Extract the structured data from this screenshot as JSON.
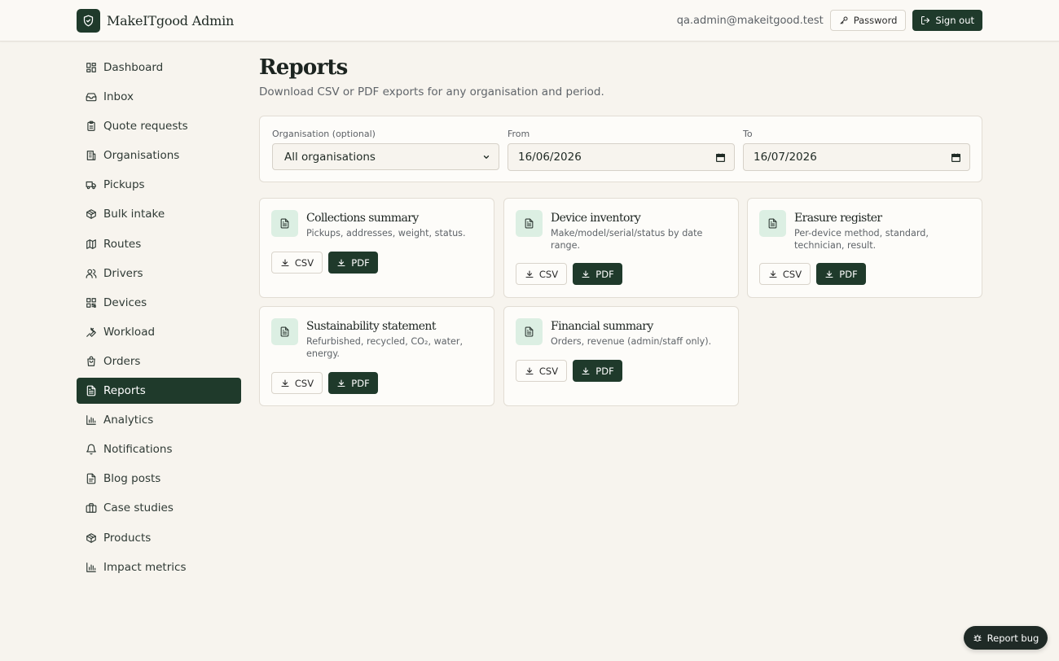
{
  "header": {
    "app_name": "MakeITgood Admin",
    "user_email": "qa.admin@makeitgood.test",
    "password_label": "Password",
    "signout_label": "Sign out"
  },
  "sidebar": {
    "items": [
      {
        "label": "Dashboard",
        "icon": "dashboard-icon"
      },
      {
        "label": "Inbox",
        "icon": "inbox-icon"
      },
      {
        "label": "Quote requests",
        "icon": "clipboard-icon"
      },
      {
        "label": "Organisations",
        "icon": "building-icon"
      },
      {
        "label": "Pickups",
        "icon": "truck-icon"
      },
      {
        "label": "Bulk intake",
        "icon": "package-icon"
      },
      {
        "label": "Routes",
        "icon": "map-icon"
      },
      {
        "label": "Drivers",
        "icon": "users-icon"
      },
      {
        "label": "Devices",
        "icon": "qr-icon"
      },
      {
        "label": "Workload",
        "icon": "wrench-icon"
      },
      {
        "label": "Orders",
        "icon": "shopping-bag-icon"
      },
      {
        "label": "Reports",
        "icon": "file-text-icon",
        "active": true
      },
      {
        "label": "Analytics",
        "icon": "bar-chart-icon"
      },
      {
        "label": "Notifications",
        "icon": "bell-icon"
      },
      {
        "label": "Blog posts",
        "icon": "file-icon"
      },
      {
        "label": "Case studies",
        "icon": "briefcase-icon"
      },
      {
        "label": "Products",
        "icon": "package-icon"
      },
      {
        "label": "Impact metrics",
        "icon": "bar-chart-icon"
      }
    ]
  },
  "main": {
    "title": "Reports",
    "subtitle": "Download CSV or PDF exports for any organisation and period.",
    "filters": {
      "org_label": "Organisation (optional)",
      "org_value": "All organisations",
      "from_label": "From",
      "from_value": "16/06/2026",
      "to_label": "To",
      "to_value": "16/07/2026"
    },
    "csv_label": "CSV",
    "pdf_label": "PDF",
    "reports": [
      {
        "title": "Collections summary",
        "desc": "Pickups, addresses, weight, status."
      },
      {
        "title": "Device inventory",
        "desc": "Make/model/serial/status by date range."
      },
      {
        "title": "Erasure register",
        "desc": "Per-device method, standard, technician, result."
      },
      {
        "title": "Sustainability statement",
        "desc": "Refurbished, recycled, CO₂, water, energy."
      },
      {
        "title": "Financial summary",
        "desc": "Orders, revenue (admin/staff only)."
      }
    ]
  },
  "report_bug_label": "Report bug",
  "colors": {
    "accent": "#1f3a2b",
    "background": "#f7f4ee",
    "card": "#fdfcf9",
    "icon_tile": "#dcefe3"
  }
}
